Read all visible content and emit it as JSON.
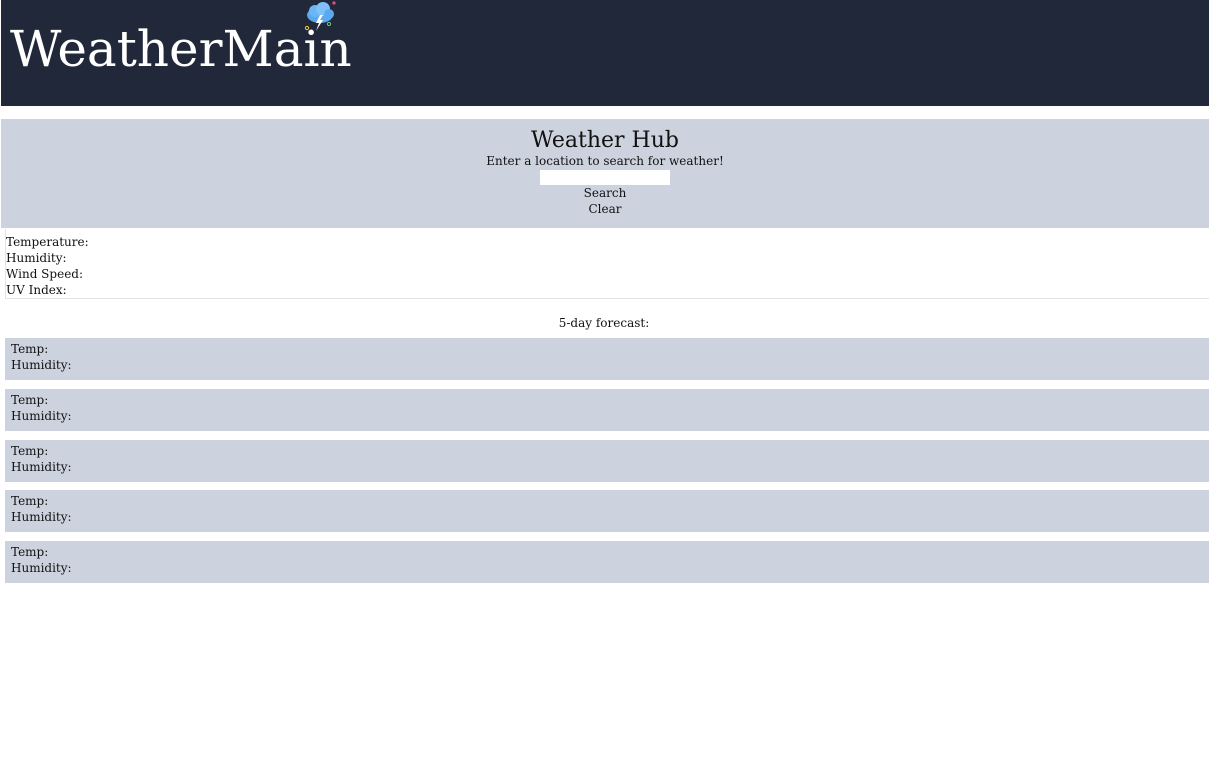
{
  "header": {
    "brand": "WeatherMain",
    "logo_icon": "cloud-lightning-icon"
  },
  "hub": {
    "title": "Weather Hub",
    "subtitle": "Enter a location to search for weather!",
    "search_value": "",
    "search_label": "Search",
    "clear_label": "Clear"
  },
  "current": {
    "temperature_label": "Temperature:",
    "humidity_label": "Humidity:",
    "wind_label": "Wind Speed:",
    "uv_label": "UV Index:"
  },
  "forecast": {
    "title": "5-day forecast:",
    "days": [
      {
        "temp_label": "Temp:",
        "humidity_label": "Humidity:"
      },
      {
        "temp_label": "Temp:",
        "humidity_label": "Humidity:"
      },
      {
        "temp_label": "Temp:",
        "humidity_label": "Humidity:"
      },
      {
        "temp_label": "Temp:",
        "humidity_label": "Humidity:"
      },
      {
        "temp_label": "Temp:",
        "humidity_label": "Humidity:"
      }
    ]
  },
  "colors": {
    "header_bg": "#212839",
    "panel_bg": "#ccd3de",
    "brand_text": "#ffffff"
  }
}
